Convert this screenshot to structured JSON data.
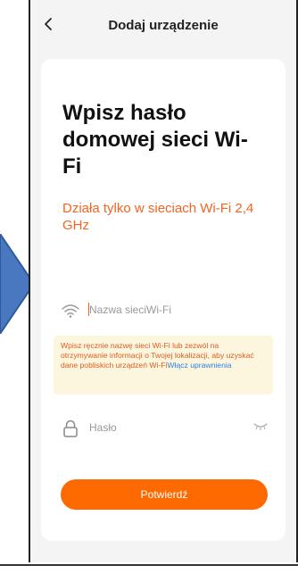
{
  "header": {
    "title": "Dodaj urządzenie",
    "back_icon": "chevron-left-icon"
  },
  "card": {
    "heading": "Wpisz hasło domowej sieci Wi-Fi",
    "subheading": "Działa tylko w sieciach Wi-Fi 2,4 GHz"
  },
  "ssid_field": {
    "icon": "wifi-icon",
    "placeholder": "Nazwa sieciWi-Fi",
    "value": ""
  },
  "warning": {
    "text": "Wpisz ręcznie nazwę sieci Wi-Fi lub zezwól na otrzymywanie informacji o Twojej lokalizacji, aby uzyskać dane pobliskich urządzeń Wi-Fi",
    "link_label": "Włącz uprawnienia"
  },
  "password_field": {
    "icon": "lock-icon",
    "placeholder": "Hasło",
    "value": "",
    "visibility_icon": "eye-closed-icon"
  },
  "confirm_button": {
    "label": "Potwierdź"
  },
  "colors": {
    "accent": "#ff6a00",
    "subheading": "#f26522",
    "warning_bg": "#fdf6df",
    "link": "#2f7fe0",
    "arrow": "#4a78c0"
  }
}
